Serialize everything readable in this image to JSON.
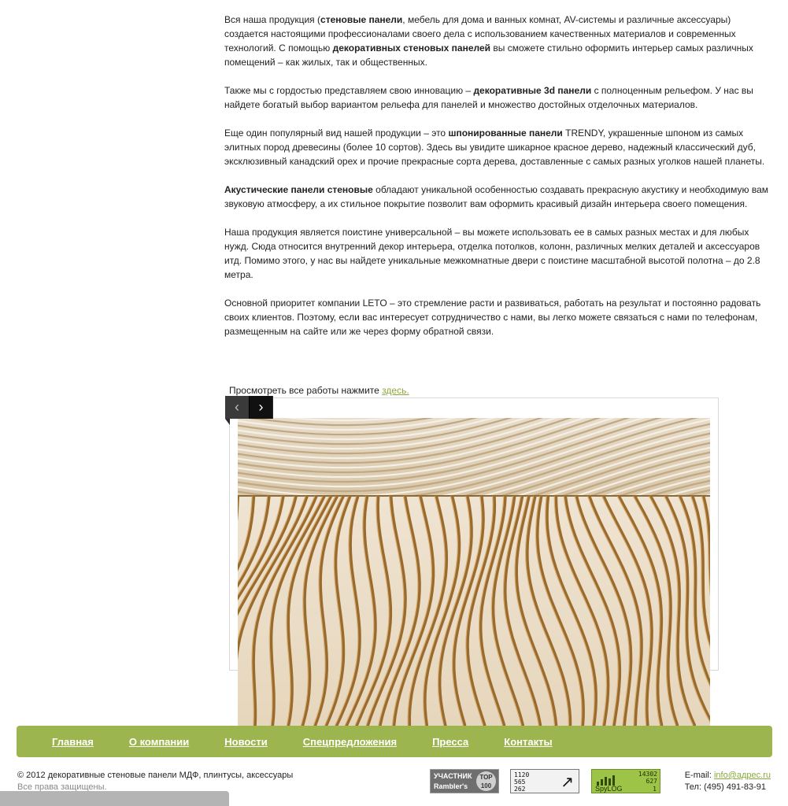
{
  "article": {
    "p1": {
      "t1": "Вся наша продукция (",
      "b1": "стеновые панели",
      "t2": ", мебель для дома и ванных комнат, AV-системы и различные аксессуары) создается настоящими профессионалами своего дела с использованием качественных материалов и современных технологий. С помощью ",
      "b2": "декоративных стеновых панелей",
      "t3": " вы сможете стильно оформить интерьер самых различных помещений – как жилых, так и общественных."
    },
    "p2": {
      "t1": "Также мы с гордостью представляем свою инновацию – ",
      "b1": "декоративные 3d панели",
      "t2": " с полноценным рельефом. У нас вы найдете богатый выбор вариантом рельефа для панелей и множество достойных отделочных материалов."
    },
    "p3": {
      "t1": "Еще один популярный вид нашей продукции – это ",
      "b1": "шпонированные панели",
      "t2": " TRENDY, украшенные шпоном из самых элитных пород древесины (более 10 сортов). Здесь вы увидите шикарное красное дерево, надежный классический дуб, эксклюзивный канадский орех и прочие прекрасные сорта дерева, доставленные с самых разных уголков нашей планеты."
    },
    "p4": {
      "b1": "Акустические панели стеновые",
      "t1": " обладают уникальной особенностью создавать прекрасную акустику и необходимую вам звуковую атмосферу, а их стильное покрытие позволит вам оформить красивый дизайн интерьера своего помещения."
    },
    "p5": {
      "t1": "Наша продукция является поистине универсальной – вы можете использовать ее в самых разных местах и для любых нужд. Сюда относится внутренний декор интерьера, отделка потолков, колонн, различных мелких деталей и аксессуаров итд. Помимо этого, у нас вы найдете уникальные межкомнатные двери с поистине масштабной высотой полотна – до 2.8 метра."
    },
    "p6": {
      "t1": "Основной приоритет компании LETO – это стремление расти и развиваться, работать на результат и постоянно радовать своих клиентов. Поэтому, если вас интересует сотрудничество с нами, вы легко можете связаться с нами по телефонам, размещенным на сайте или же через форму обратной связи."
    }
  },
  "view_all": {
    "text": "Просмотреть все работы нажмите ",
    "link": "здесь."
  },
  "slider": {
    "prev_icon": "chevron-left-icon",
    "next_icon": "chevron-right-icon",
    "prev_glyph": "‹",
    "next_glyph": "›"
  },
  "footer_nav": {
    "items": [
      {
        "label": "Главная"
      },
      {
        "label": "О компании"
      },
      {
        "label": "Новости"
      },
      {
        "label": "Спецпредложения"
      },
      {
        "label": "Пресса"
      },
      {
        "label": "Контакты"
      }
    ]
  },
  "footer": {
    "copyright": "© 2012 декоративные стеновые панели МДФ, плинтусы, аксессуары",
    "rights": "Все права защищены.",
    "email_label": "E-mail: ",
    "email": "info@адрес.ru",
    "phone": "Тел: (495) 491-83-91"
  },
  "counters": {
    "rambler": {
      "line1": "УЧАСТНИК",
      "line2": "Rambler's",
      "badge": "TOP 100"
    },
    "liveinternet": {
      "n1": "1120",
      "n2": "565",
      "n3": "262"
    },
    "spylog": {
      "n1": "14302",
      "n2": "627",
      "n3": "1",
      "brand": "SpyLOG"
    }
  },
  "colors": {
    "accent_green": "#9cb54e",
    "link_green": "#8aa83e"
  }
}
